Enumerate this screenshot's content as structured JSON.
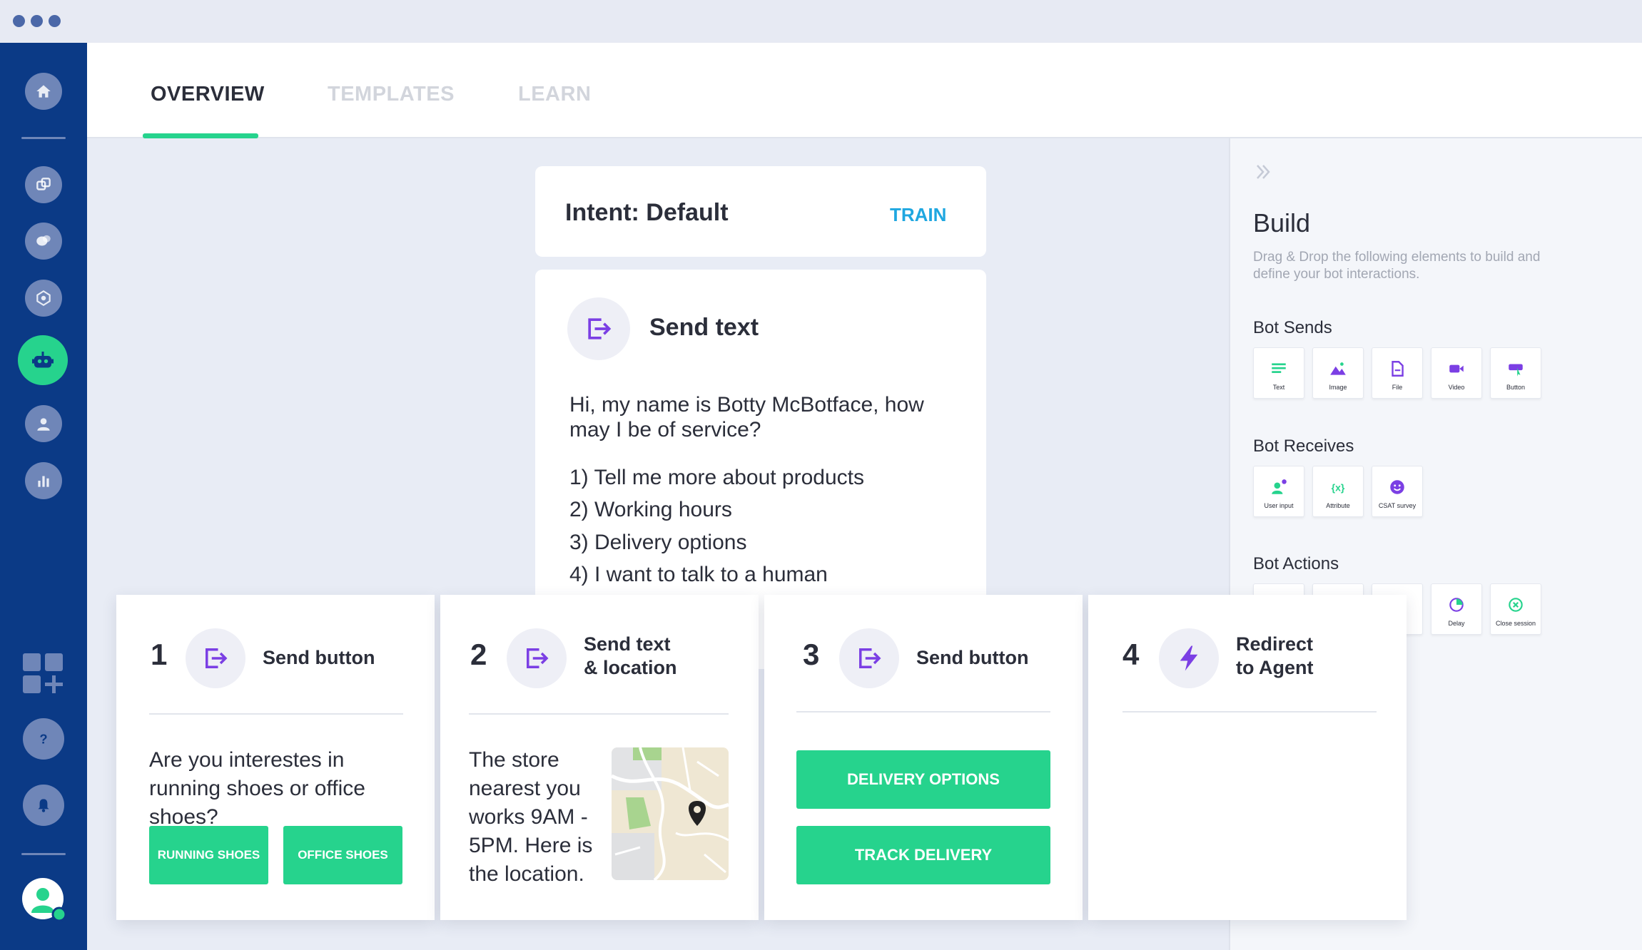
{
  "tabs": [
    {
      "label": "OVERVIEW",
      "active": true
    },
    {
      "label": "TEMPLATES",
      "active": false
    },
    {
      "label": "LEARN",
      "active": false
    }
  ],
  "sidebar": {
    "icons": [
      "home-icon",
      "integrations-icon",
      "conversations-icon",
      "network-icon",
      "bot-icon",
      "people-icon",
      "analytics-icon",
      "add-apps-icon",
      "help-icon",
      "notifications-icon",
      "user-avatar-icon"
    ],
    "active": "bot-icon"
  },
  "intent": {
    "title": "Intent: Default",
    "train_label": "TRAIN"
  },
  "send_text": {
    "title": "Send text",
    "message": "Hi, my name is Botty McBotface, how may I be of service?",
    "options": [
      "1) Tell me more about products",
      "2) Working hours",
      "3) Delivery options",
      "4) I want to talk to a human"
    ]
  },
  "build": {
    "title": "Build",
    "description": "Drag & Drop the following elements to build and define your bot interactions.",
    "bot_sends": {
      "label": "Bot Sends",
      "items": [
        "Text",
        "Image",
        "File",
        "Video",
        "Button"
      ]
    },
    "bot_receives": {
      "label": "Bot Receives",
      "items": [
        "User input",
        "Attribute",
        "CSAT survey"
      ]
    },
    "bot_actions": {
      "label": "Bot Actions",
      "items": [
        "Delay",
        "Close session"
      ]
    }
  },
  "steps": [
    {
      "number": "1",
      "title": "Send button",
      "text": "Are you interestes in running shoes or office shoes?",
      "buttons": [
        "RUNNING SHOES",
        "OFFICE SHOES"
      ]
    },
    {
      "number": "2",
      "title_line1": "Send text",
      "title_line2": "& location",
      "text": "The store nearest you works 9AM - 5PM. Here is the location."
    },
    {
      "number": "3",
      "title": "Send button",
      "buttons": [
        "DELIVERY OPTIONS",
        "TRACK DELIVERY"
      ]
    },
    {
      "number": "4",
      "title_line1": "Redirect",
      "title_line2": "to Agent"
    }
  ],
  "colors": {
    "sidebar": "#0b3a86",
    "accent_green": "#26d38d",
    "accent_purple": "#7b3fe4",
    "link_blue": "#1fa7e0",
    "background": "#e8ecf5"
  }
}
